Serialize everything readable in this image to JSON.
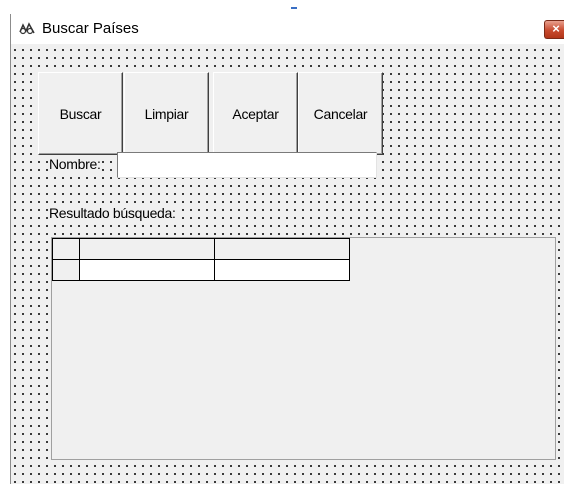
{
  "window": {
    "title": "Buscar Países",
    "close_label": "×"
  },
  "toolbar": {
    "buttons": [
      {
        "label": "Buscar"
      },
      {
        "label": "Limpiar"
      },
      {
        "label": "Aceptar"
      },
      {
        "label": "Cancelar"
      }
    ]
  },
  "form": {
    "name_label": "Nombre:",
    "name_value": "",
    "result_label": "Resultado búsqueda:"
  },
  "results_grid": {
    "columns": [
      "",
      ""
    ],
    "rows": [
      [
        "",
        ""
      ]
    ]
  },
  "icons": {
    "app": "app-icon",
    "close": "close-icon"
  },
  "colors": {
    "form_background": "#f0f0f0",
    "close_button": "#c84a2e"
  }
}
